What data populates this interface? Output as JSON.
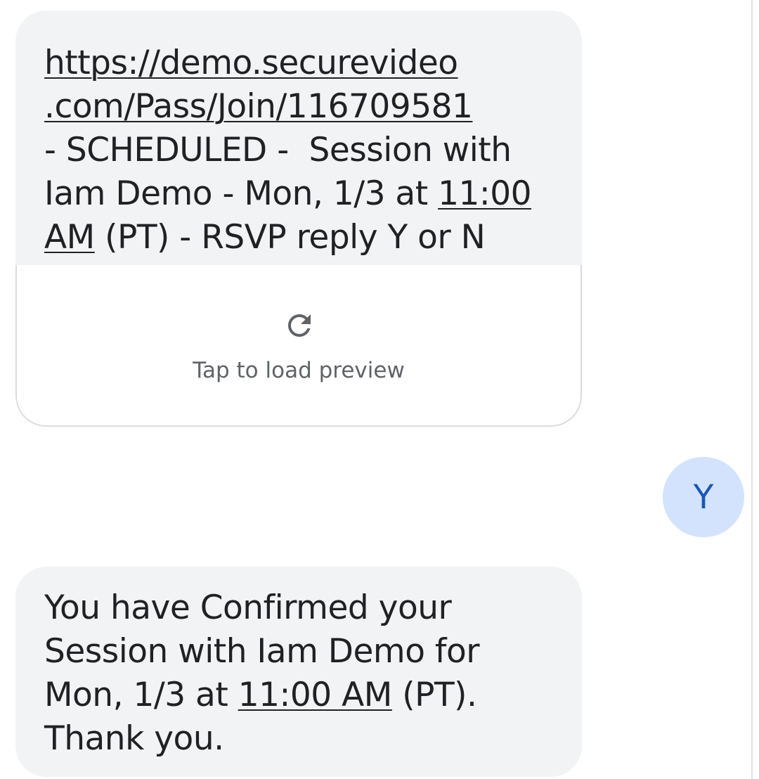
{
  "messages": {
    "first": {
      "lines": [
        "https://demo.securevideo",
        ".com/Pass/Join/116709581",
        "- SCHEDULED -  Session with",
        "Iam Demo - Mon, 1/3 at ",
        "11:00",
        "AM",
        " (PT) - RSVP reply Y or N"
      ],
      "preview": {
        "icon": "refresh-icon",
        "label": "Tap to load preview"
      }
    },
    "reply": {
      "text": "Y"
    },
    "confirmation": {
      "lines": [
        "You have Confirmed your",
        "Session with Iam Demo for",
        "Mon, 1/3 at ",
        "11:00 AM",
        " (PT).",
        "Thank you."
      ]
    }
  },
  "colors": {
    "incoming_bubble": "#f1f3f4",
    "outgoing_bubble": "#d3e3fd",
    "outgoing_text": "#1a56b8",
    "preview_text": "#5f6368"
  }
}
